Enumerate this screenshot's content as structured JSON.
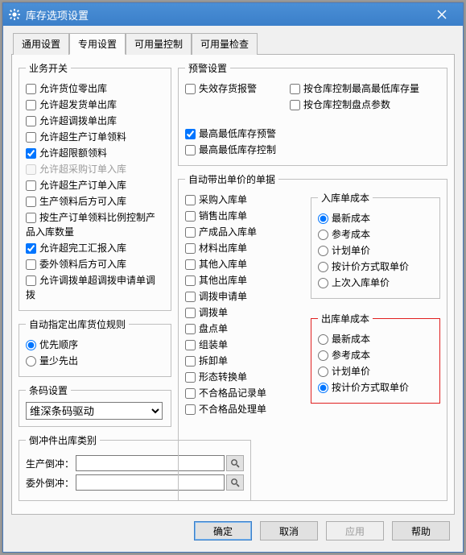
{
  "title": "库存选项设置",
  "tabs": [
    "通用设置",
    "专用设置",
    "可用量控制",
    "可用量检查"
  ],
  "activeTab": 1,
  "business": {
    "legend": "业务开关",
    "items": [
      {
        "label": "允许货位零出库",
        "checked": false
      },
      {
        "label": "允许超发货单出库",
        "checked": false
      },
      {
        "label": "允许超调拨单出库",
        "checked": false
      },
      {
        "label": "允许超生产订单领料",
        "checked": false
      },
      {
        "label": "允许超限额领料",
        "checked": true
      },
      {
        "label": "允许超采购订单入库",
        "checked": false,
        "disabled": true
      },
      {
        "label": "允许超生产订单入库",
        "checked": false
      },
      {
        "label": "生产领料后方可入库",
        "checked": false
      },
      {
        "label": "按生产订单领料比例控制产品入库数量",
        "checked": false
      },
      {
        "label": "允许超完工汇报入库",
        "checked": true
      },
      {
        "label": "委外领料后方可入库",
        "checked": false
      },
      {
        "label": "允许调拨单超调拨申请单调拨",
        "checked": false
      }
    ]
  },
  "autoLocate": {
    "legend": "自动指定出库货位规则",
    "options": [
      {
        "label": "优先顺序",
        "checked": true
      },
      {
        "label": "量少先出",
        "checked": false
      }
    ]
  },
  "barcode": {
    "legend": "条码设置",
    "value": "维深条码驱动"
  },
  "hedge": {
    "legend": "倒冲件出库类别",
    "rows": [
      {
        "label": "生产倒冲：",
        "value": ""
      },
      {
        "label": "委外倒冲：",
        "value": ""
      }
    ]
  },
  "alert": {
    "legend": "预警设置",
    "left": [
      {
        "label": "失效存货报警",
        "checked": false
      }
    ],
    "right": [
      {
        "label": "按仓库控制最高最低库存量",
        "checked": false
      },
      {
        "label": "按仓库控制盘点参数",
        "checked": false
      }
    ],
    "below": [
      {
        "label": "最高最低库存预警",
        "checked": true
      },
      {
        "label": "最高最低库存控制",
        "checked": false
      }
    ]
  },
  "autoPrice": {
    "legend": "自动带出单价的单据",
    "docs": [
      {
        "label": "采购入库单",
        "checked": false
      },
      {
        "label": "销售出库单",
        "checked": false
      },
      {
        "label": "产成品入库单",
        "checked": false
      },
      {
        "label": "材料出库单",
        "checked": false
      },
      {
        "label": "其他入库单",
        "checked": false
      },
      {
        "label": "其他出库单",
        "checked": false
      },
      {
        "label": "调拨申请单",
        "checked": false
      },
      {
        "label": "调拨单",
        "checked": false
      },
      {
        "label": "盘点单",
        "checked": false
      },
      {
        "label": "组装单",
        "checked": false
      },
      {
        "label": "拆卸单",
        "checked": false
      },
      {
        "label": "形态转换单",
        "checked": false
      },
      {
        "label": "不合格品记录单",
        "checked": false
      },
      {
        "label": "不合格品处理单",
        "checked": false
      }
    ],
    "inCost": {
      "legend": "入库单成本",
      "options": [
        {
          "label": "最新成本",
          "checked": true
        },
        {
          "label": "参考成本",
          "checked": false
        },
        {
          "label": "计划单价",
          "checked": false
        },
        {
          "label": "按计价方式取单价",
          "checked": false
        },
        {
          "label": "上次入库单价",
          "checked": false
        }
      ]
    },
    "outCost": {
      "legend": "出库单成本",
      "options": [
        {
          "label": "最新成本",
          "checked": false
        },
        {
          "label": "参考成本",
          "checked": false
        },
        {
          "label": "计划单价",
          "checked": false
        },
        {
          "label": "按计价方式取单价",
          "checked": true
        }
      ]
    }
  },
  "buttons": {
    "ok": "确定",
    "cancel": "取消",
    "apply": "应用",
    "help": "帮助"
  }
}
